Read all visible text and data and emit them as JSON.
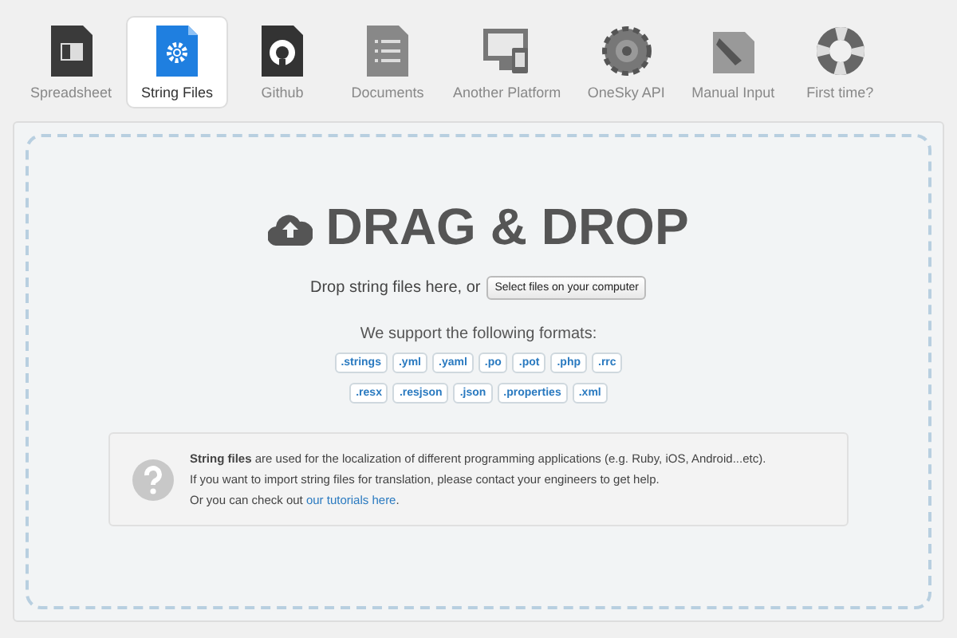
{
  "tabs": [
    {
      "kind": "spreadsheet",
      "label": "Spreadsheet",
      "selected": false
    },
    {
      "kind": "settings",
      "label": "String Files",
      "selected": true
    },
    {
      "kind": "github",
      "label": "Github",
      "selected": false
    },
    {
      "kind": "document",
      "label": "Documents",
      "selected": false
    },
    {
      "kind": "platform",
      "label": "Another Platform",
      "selected": false
    },
    {
      "kind": "api",
      "label": "OneSky API",
      "selected": false
    },
    {
      "kind": "manual",
      "label": "Manual Input",
      "selected": false
    },
    {
      "kind": "help",
      "label": "First time?",
      "selected": false
    }
  ],
  "drop": {
    "title": "DRAG & DROP",
    "prompt": "Drop string files here, or",
    "button": "Select files on your computer",
    "formats_heading": "We support the following formats:",
    "format_rows": [
      [
        ".strings",
        ".yml",
        ".yaml",
        ".po",
        ".pot",
        ".php",
        ".rrc"
      ],
      [
        ".resx",
        ".resjson",
        ".json",
        ".properties",
        ".xml"
      ]
    ]
  },
  "info": {
    "line_1": "**String files** are used for the localization of different programming applications (e.g. Ruby, iOS, Android...etc).",
    "line_2": "If you want to import string files for translation, please contact your engineers to get help.",
    "line_3_prefix": "Or you can check out ",
    "link": "our tutorials here",
    "line_3_suffix": "."
  }
}
